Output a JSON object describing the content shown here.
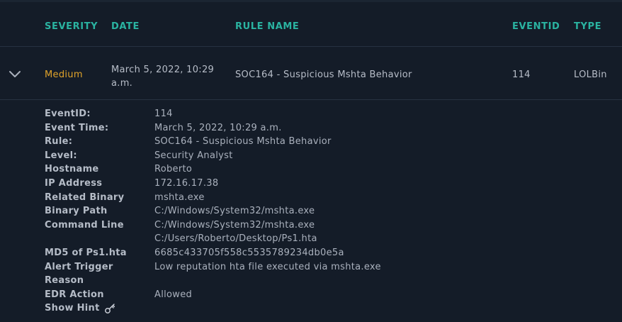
{
  "table": {
    "headers": {
      "severity": "SEVERITY",
      "date": "DATE",
      "rule_name": "RULE NAME",
      "eventid": "EVENTID",
      "type": "TYPE"
    },
    "row": {
      "severity": "Medium",
      "date_line1": "March 5, 2022, 10:29",
      "date_line2": "a.m.",
      "rule_name": "SOC164 - Suspicious Mshta Behavior",
      "eventid": "114",
      "type": "LOLBin",
      "expand_icon": "chevron-down-icon"
    }
  },
  "details": {
    "event_id": {
      "label": "EventID:",
      "value": "114"
    },
    "event_time": {
      "label": "Event Time:",
      "value": "March 5, 2022, 10:29 a.m."
    },
    "rule": {
      "label": "Rule:",
      "value": "SOC164 - Suspicious Mshta Behavior"
    },
    "level": {
      "label": "Level:",
      "value": "Security Analyst"
    },
    "hostname": {
      "label": "Hostname",
      "value": "Roberto"
    },
    "ip_address": {
      "label": "IP Address",
      "value": "172.16.17.38"
    },
    "related_binary": {
      "label": "Related Binary",
      "value": "mshta.exe"
    },
    "binary_path": {
      "label": "Binary Path",
      "value": "C:/Windows/System32/mshta.exe"
    },
    "command_line": {
      "label": "Command Line",
      "value_line1": "C:/Windows/System32/mshta.exe",
      "value_line2": "C:/Users/Roberto/Desktop/Ps1.hta"
    },
    "md5": {
      "label": "MD5 of Ps1.hta",
      "value": "6685c433705f558c5535789234db0e5a"
    },
    "alert_trigger": {
      "label_line1": "Alert Trigger",
      "label_line2": "Reason",
      "value": "Low reputation hta file executed via mshta.exe"
    },
    "edr_action": {
      "label": "EDR Action",
      "value": "Allowed"
    },
    "show_hint": {
      "label": "Show Hint",
      "icon": "key-icon"
    }
  },
  "colors": {
    "background": "#141c28",
    "header_accent": "#2ab3a1",
    "severity_medium": "#e0a32a",
    "text": "#aab1bd"
  }
}
